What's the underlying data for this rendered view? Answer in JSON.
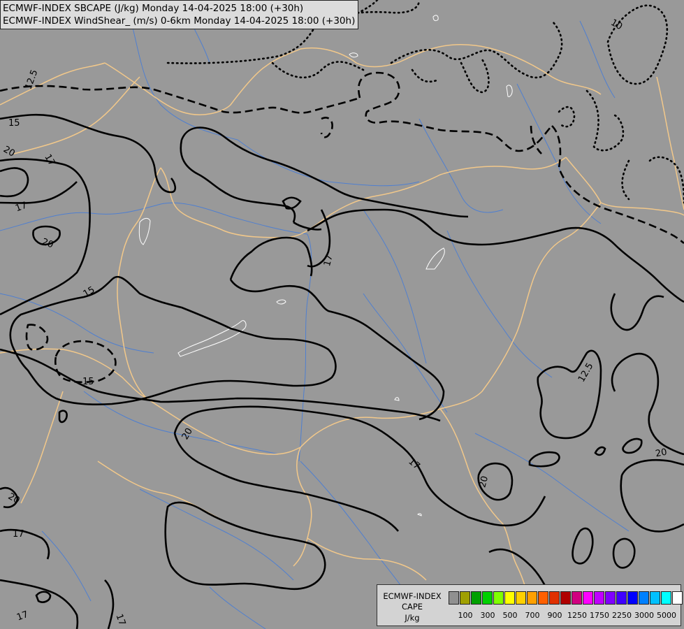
{
  "header": {
    "line1": "ECMWF-INDEX SBCAPE (J/kg) Monday 14-04-2025 18:00 (+30h)",
    "line2": "ECMWF-INDEX WindShear_ (m/s) 0-6km Monday 14-04-2025 18:00 (+30h)"
  },
  "legend": {
    "title1": "ECMWF-INDEX",
    "title2": "CAPE",
    "unit": "J/kg",
    "colors": [
      "#909090",
      "#a0a000",
      "#00a000",
      "#00d000",
      "#80ff00",
      "#ffff00",
      "#ffd000",
      "#ffa000",
      "#ff6000",
      "#e03000",
      "#b00000",
      "#d00080",
      "#ff00ff",
      "#c000ff",
      "#8000ff",
      "#4000ff",
      "#0000ff",
      "#0080ff",
      "#00c0ff",
      "#00ffff",
      "#ffffff"
    ],
    "ticks": [
      "100",
      "300",
      "500",
      "700",
      "900",
      "1250",
      "1750",
      "2250",
      "3000",
      "5000"
    ]
  },
  "map": {
    "background": "#999999",
    "contour_color": "#000000",
    "border_color": "#f2c88a",
    "river_color": "#4f7fd0",
    "lake_outline_color": "#ffffff",
    "contour_labels": [
      "10",
      "12.5",
      "15",
      "17",
      "20",
      "17",
      "15",
      "20",
      "17",
      "20",
      "15",
      "17",
      "12.5",
      "20",
      "20",
      "17",
      "20",
      "17",
      "17",
      "15"
    ]
  }
}
